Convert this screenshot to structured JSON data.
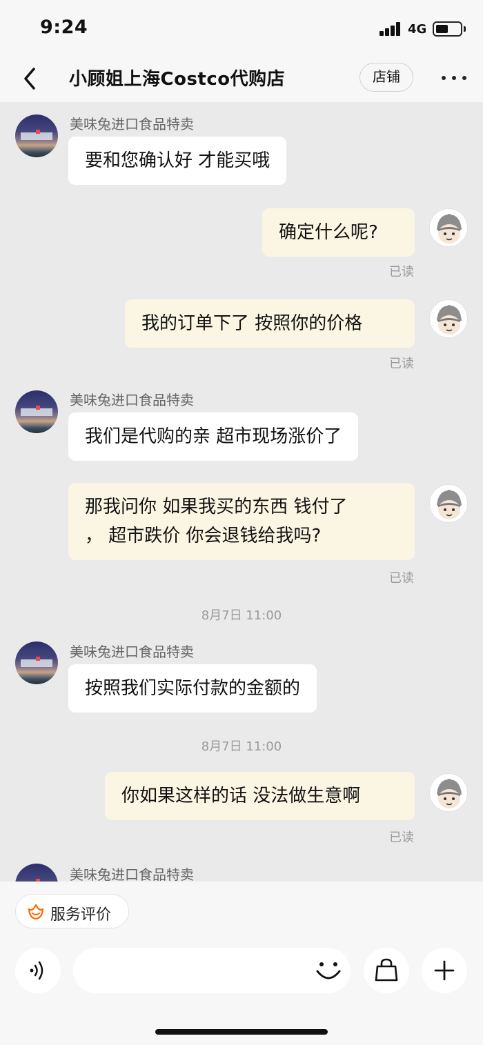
{
  "status_bar": {
    "time": "9:24",
    "network": "4G"
  },
  "header": {
    "title": "小顾姐上海Costco代购店",
    "shop_button": "店铺"
  },
  "messages": [
    {
      "direction": "in",
      "sender": "美味兔进口食品特卖",
      "text": "要和您确认好 才能买哦"
    },
    {
      "direction": "out",
      "text": "确定什么呢?",
      "status": "已读"
    },
    {
      "direction": "out",
      "text": "我的订单下了 按照你的价格",
      "status": "已读"
    },
    {
      "direction": "in",
      "sender": "美味兔进口食品特卖",
      "text": "我们是代购的亲 超市现场涨价了"
    },
    {
      "direction": "out",
      "lines": [
        "那我问你 如果我买的东西 钱付了",
        "， 超市跌价 你会退钱给我吗?"
      ],
      "status": "已读"
    },
    {
      "type": "timestamp",
      "text": "8月7日 11:00"
    },
    {
      "direction": "in",
      "sender": "美味兔进口食品特卖",
      "text": "按照我们实际付款的金额的"
    },
    {
      "type": "timestamp",
      "text": "8月7日 11:00"
    },
    {
      "direction": "out",
      "text": "你如果这样的话 没法做生意啊",
      "status": "已读"
    },
    {
      "direction": "in",
      "sender": "美味兔进口食品特卖",
      "partial": true
    }
  ],
  "bottom": {
    "service_label": "服务评价",
    "input_value": "",
    "input_placeholder": ""
  },
  "icons": [
    "back-icon",
    "more-icon",
    "voice-icon",
    "emoji-icon",
    "bag-icon",
    "plus-icon",
    "flower-icon"
  ],
  "colors": {
    "background": "#eaeaea",
    "incoming_bubble": "#ffffff",
    "outgoing_bubble": "#fbf5e3",
    "service_icon": "#ff6a00"
  }
}
